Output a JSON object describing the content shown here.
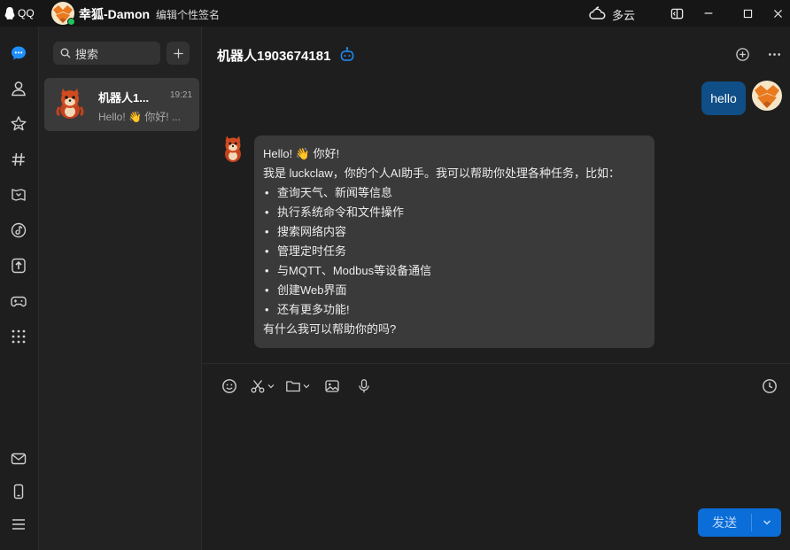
{
  "titlebar": {
    "app_name": "QQ",
    "user_name": "幸狐-Damon",
    "signature_placeholder": "编辑个性签名",
    "weather": "多云",
    "weather_icon": "cloud-icon",
    "status_color": "#21c55d"
  },
  "nav": {
    "items": [
      "messages-icon",
      "contacts-icon",
      "favorites-icon",
      "channels-icon",
      "games-icon",
      "music-icon",
      "upload-icon",
      "gamepad-icon",
      "apps-grid-icon",
      "mail-icon",
      "phone-icon",
      "menu-icon"
    ],
    "active_color": "#1e8fff"
  },
  "conv_list": {
    "search_placeholder": "搜索",
    "items": [
      {
        "name": "机器人1...",
        "time": "19:21",
        "preview": "Hello! 👋 你好! ..."
      }
    ]
  },
  "chat": {
    "title": "机器人1903674181",
    "messages": {
      "self_text": "hello",
      "bot_greeting": "Hello! 👋 你好!",
      "bot_intro": "我是 luckclaw，你的个人AI助手。我可以帮助你处理各种任务，比如：",
      "bot_items": [
        "查询天气、新闻等信息",
        "执行系统命令和文件操作",
        "搜索网络内容",
        "管理定时任务",
        "与MQTT、Modbus等设备通信",
        "创建Web界面",
        "还有更多功能!"
      ],
      "bot_outro": "有什么我可以帮助你的吗?"
    },
    "self_bubble_color": "#0f4e86",
    "bot_bubble_color": "#3a3a3a"
  },
  "input": {
    "send_label": "发送",
    "send_color": "#0a6dd8"
  }
}
